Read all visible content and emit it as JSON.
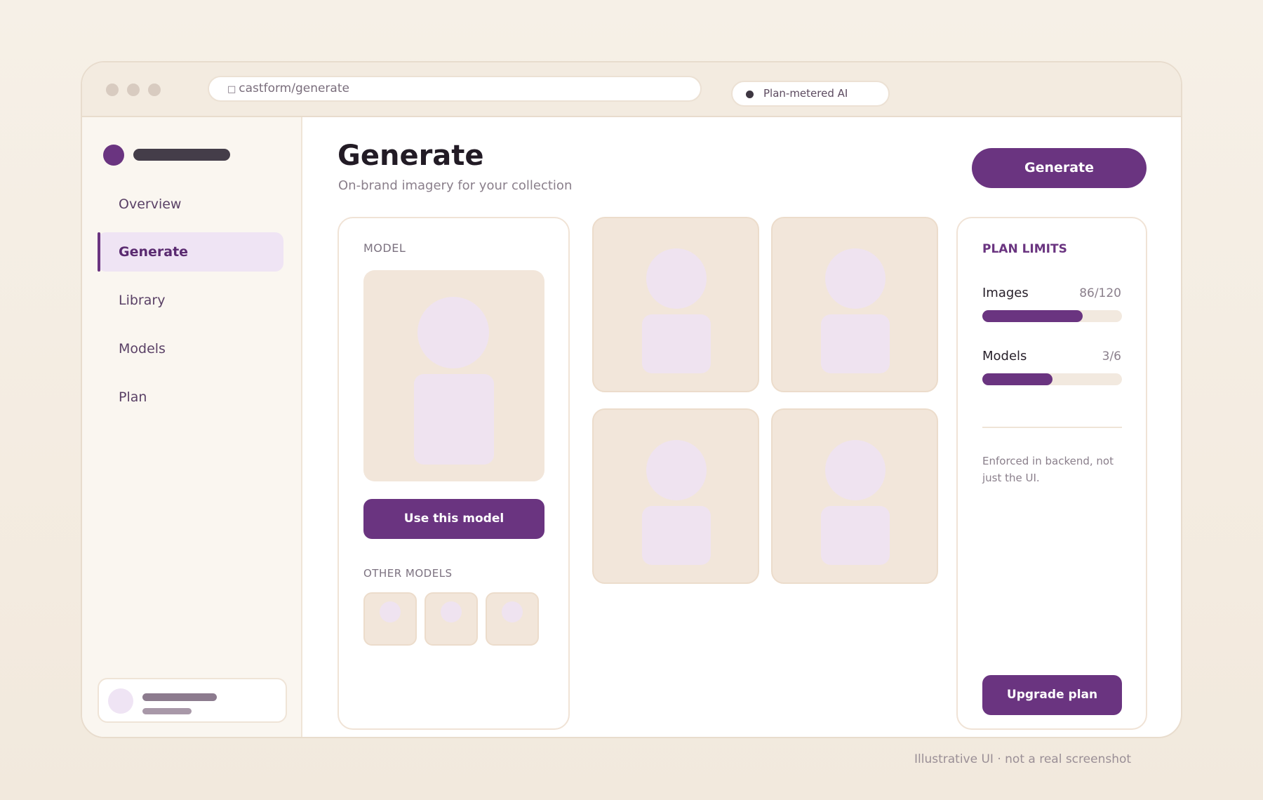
{
  "browser": {
    "url": "castform/generate",
    "status_pill": "Plan-metered AI"
  },
  "sidebar": {
    "items": [
      {
        "label": "Overview"
      },
      {
        "label": "Generate",
        "active": true
      },
      {
        "label": "Library"
      },
      {
        "label": "Models"
      },
      {
        "label": "Plan"
      }
    ]
  },
  "header": {
    "title": "Generate",
    "subtitle": "On-brand imagery for your collection",
    "generate_button": "Generate"
  },
  "model_panel": {
    "label": "MODEL",
    "use_button": "Use this model",
    "other_label": "OTHER MODELS"
  },
  "limits": {
    "title": "PLAN LIMITS",
    "items": [
      {
        "name": "Images",
        "value": "86/120",
        "fraction": 0.717
      },
      {
        "name": "Models",
        "value": "3/6",
        "fraction": 0.5
      }
    ],
    "note": "Enforced in backend, not just the UI.",
    "upgrade_button": "Upgrade plan"
  },
  "footer": "Illustrative UI · not a real screenshot",
  "colors": {
    "accent": "#6a3480",
    "accent_light": "#efe4f4",
    "tile": "#f2e6da"
  }
}
